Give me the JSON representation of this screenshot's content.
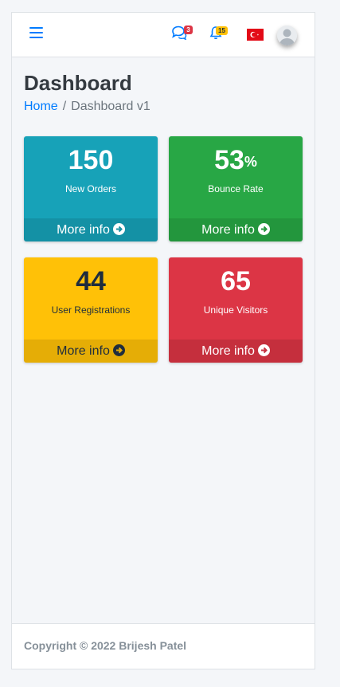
{
  "navbar": {
    "messages_badge": "3",
    "notifications_badge": "15"
  },
  "header": {
    "title": "Dashboard",
    "breadcrumb": {
      "home": "Home",
      "separator": "/",
      "current": "Dashboard v1"
    }
  },
  "cards": [
    {
      "value": "150",
      "suffix": "",
      "label": "New Orders",
      "footer": "More info",
      "color": "#17a2b8"
    },
    {
      "value": "53",
      "suffix": "%",
      "label": "Bounce Rate",
      "footer": "More info",
      "color": "#28a745"
    },
    {
      "value": "44",
      "suffix": "",
      "label": "User Registrations",
      "footer": "More info",
      "color": "#ffc107"
    },
    {
      "value": "65",
      "suffix": "",
      "label": "Unique Visitors",
      "footer": "More info",
      "color": "#dc3545"
    }
  ],
  "footer": {
    "copyright": "Copyright © 2022 Brijesh Patel"
  },
  "colors": {
    "primary": "#007bff",
    "flag_red": "#e30a17"
  }
}
